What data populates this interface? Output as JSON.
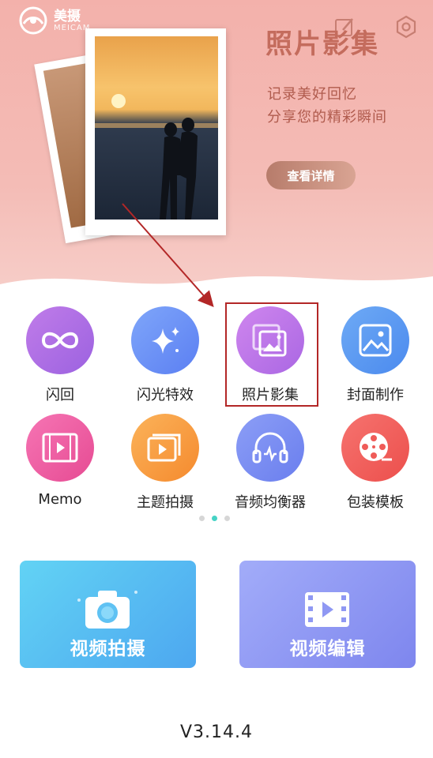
{
  "logo": {
    "name_cn": "美摄",
    "name_en": "MEICAM"
  },
  "banner": {
    "title": "照片影集",
    "subtitle_line1": "记录美好回忆",
    "subtitle_line2": "分享您的精彩瞬间",
    "button_label": "查看详情"
  },
  "features": [
    {
      "label": "闪回",
      "icon": "infinity-icon",
      "color": "#b471e6"
    },
    {
      "label": "闪光特效",
      "icon": "sparkle-icon",
      "color": "#6d8ff7"
    },
    {
      "label": "照片影集",
      "icon": "photo-album-icon",
      "color": "#c178ea"
    },
    {
      "label": "封面制作",
      "icon": "image-icon",
      "color": "#5d9cf2"
    },
    {
      "label": "Memo",
      "icon": "film-icon",
      "color": "#ef60a3"
    },
    {
      "label": "主题拍摄",
      "icon": "video-play-icon",
      "color": "#f79a3f"
    },
    {
      "label": "音频均衡器",
      "icon": "headphones-icon",
      "color": "#7a8cf2"
    },
    {
      "label": "包装模板",
      "icon": "film-reel-icon",
      "color": "#f0605d"
    }
  ],
  "cards": {
    "shoot_label": "视频拍摄",
    "edit_label": "视频编辑"
  },
  "version": "V3.14.4"
}
